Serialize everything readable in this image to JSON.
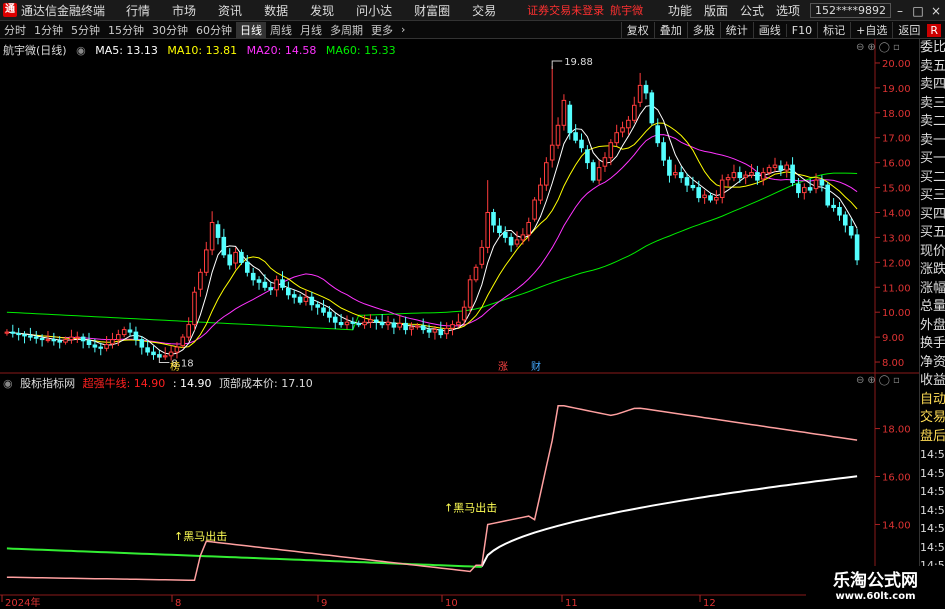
{
  "app": {
    "title": "通达信金融终端",
    "menu": [
      "行情",
      "市场",
      "资讯",
      "数据",
      "发现",
      "问小达",
      "财富圈",
      "交易"
    ],
    "login_warning": "证券交易未登录",
    "stock_name": "航宇微",
    "right_menu": [
      "功能",
      "版面",
      "公式",
      "选项"
    ],
    "user": "152****9892",
    "window_buttons": [
      "–",
      "□",
      "×"
    ]
  },
  "period_bar": {
    "periods": [
      "分时",
      "1分钟",
      "5分钟",
      "15分钟",
      "30分钟",
      "60分钟",
      "日线",
      "周线",
      "月线",
      "多周期",
      "更多"
    ],
    "active": "日线",
    "more_icon": "chevron-right-icon",
    "tools": [
      "复权",
      "叠加",
      "多股",
      "统计",
      "画线",
      "F10",
      "标记",
      "+自选",
      "返回"
    ],
    "r_badge": "R"
  },
  "legend": {
    "stock": "航宇微(日线)",
    "ma": [
      {
        "label": "MA5: 13.13",
        "color": "#ffffff"
      },
      {
        "label": "MA10: 13.81",
        "color": "#ffff00"
      },
      {
        "label": "MA20: 14.58",
        "color": "#ff33ff"
      },
      {
        "label": "MA60: 15.33",
        "color": "#00ee00"
      }
    ]
  },
  "indicator_legend": {
    "name": "股标指标网",
    "line1_label": "超强牛线: 14.90",
    "line1_color": "#ff2020",
    "line2_label": ": 14.90",
    "line3_label": "顶部成本价: 17.10"
  },
  "side_panel": [
    "委比",
    "卖五",
    "卖四",
    "卖三",
    "卖二",
    "卖一",
    "买一",
    "买二",
    "买三",
    "买四",
    "买五",
    "现价",
    "涨跌",
    "涨幅",
    "总量",
    "外盘",
    "换手",
    "净资",
    "收益",
    "自动",
    "交易",
    "盘后",
    "14:56",
    "14:56",
    "14:56",
    "14:56",
    "14:56",
    "14:56",
    "14:56",
    "14:56"
  ],
  "annotations": {
    "high": "19.88",
    "low": "8.18",
    "marks": [
      "榜",
      "涨",
      "财"
    ],
    "signals": [
      "黑马出击",
      "黑马出击"
    ]
  },
  "watermark": {
    "line1": "乐淘公式网",
    "line2": "www.60lt.com"
  },
  "chart_data": [
    {
      "type": "candlestick",
      "title": "航宇微(日线)",
      "ylim": [
        7.6,
        20.4
      ],
      "yticks": [
        8.0,
        9.0,
        10.0,
        11.0,
        12.0,
        13.0,
        14.0,
        15.0,
        16.0,
        17.0,
        18.0,
        19.0,
        20.0
      ],
      "x_labels": [
        "2024年",
        "8",
        "9",
        "10",
        "11",
        "12"
      ],
      "high_marker": 19.88,
      "low_marker": 8.18,
      "closes": [
        9.2,
        9.15,
        9.1,
        9.05,
        9.0,
        8.95,
        8.9,
        8.9,
        8.85,
        8.8,
        8.9,
        9.0,
        9.0,
        8.85,
        8.7,
        8.6,
        8.55,
        8.7,
        8.9,
        9.1,
        9.3,
        9.2,
        8.9,
        8.6,
        8.4,
        8.3,
        8.2,
        8.25,
        8.4,
        8.6,
        9.0,
        9.5,
        10.8,
        11.6,
        12.5,
        13.6,
        13.0,
        12.3,
        11.9,
        12.4,
        12.0,
        11.6,
        11.3,
        11.2,
        11.0,
        10.9,
        11.3,
        11.0,
        10.7,
        10.6,
        10.4,
        10.6,
        10.3,
        10.2,
        10.0,
        9.8,
        9.6,
        9.5,
        9.6,
        9.55,
        9.5,
        9.6,
        9.7,
        9.6,
        9.5,
        9.6,
        9.4,
        9.55,
        9.3,
        9.4,
        9.45,
        9.3,
        9.2,
        9.3,
        9.1,
        9.35,
        9.5,
        9.6,
        10.2,
        11.3,
        11.8,
        12.6,
        14.0,
        13.5,
        13.2,
        13.0,
        12.7,
        12.9,
        13.1,
        13.6,
        14.5,
        15.1,
        16.0,
        16.7,
        17.5,
        18.5,
        17.2,
        16.9,
        16.6,
        16.0,
        15.3,
        15.8,
        16.2,
        16.8,
        17.2,
        17.4,
        17.7,
        18.3,
        19.1,
        18.8,
        17.6,
        16.8,
        16.1,
        15.5,
        15.6,
        15.4,
        15.1,
        15.0,
        14.6,
        14.7,
        14.5,
        14.6,
        15.3,
        15.4,
        15.6,
        15.4,
        15.5,
        15.6,
        15.3,
        15.6,
        15.8,
        15.9,
        15.7,
        15.9,
        15.2,
        14.8,
        15.0,
        14.9,
        15.3,
        15.1,
        14.3,
        14.2,
        13.9,
        13.5,
        13.1,
        12.1
      ],
      "series": [
        {
          "name": "MA5",
          "value": 13.13
        },
        {
          "name": "MA10",
          "value": 13.81
        },
        {
          "name": "MA20",
          "value": 14.58
        },
        {
          "name": "MA60",
          "value": 15.33
        }
      ]
    },
    {
      "type": "line",
      "title": "股标指标网",
      "ylim": [
        11.1,
        19.9
      ],
      "yticks": [
        12.0,
        14.0,
        16.0,
        18.0
      ],
      "series": [
        {
          "name": "超强牛线",
          "value": 14.9
        },
        {
          "name": "顶部成本价",
          "value": 17.1
        }
      ]
    }
  ]
}
